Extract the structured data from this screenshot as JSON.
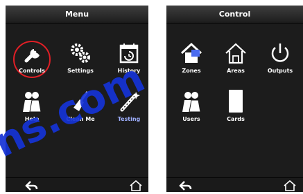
{
  "menu_panel": {
    "title": "Menu",
    "items": [
      {
        "label": "Controls",
        "icon": "wrench-icon"
      },
      {
        "label": "Settings",
        "icon": "gears-icon"
      },
      {
        "label": "History",
        "icon": "calendar-history-icon"
      },
      {
        "label": "Help",
        "icon": "people-icon"
      },
      {
        "label": "Clean Me",
        "icon": "brush-icon"
      },
      {
        "label": "Testing",
        "icon": "wand-icon"
      }
    ]
  },
  "control_panel": {
    "title": "Control",
    "items": [
      {
        "label": "Zones",
        "icon": "house-zone-icon"
      },
      {
        "label": "Areas",
        "icon": "house-outline-icon"
      },
      {
        "label": "Outputs",
        "icon": "power-icon"
      },
      {
        "label": "Users",
        "icon": "people-icon"
      },
      {
        "label": "Cards",
        "icon": "card-icon"
      }
    ]
  },
  "colors": {
    "highlight": "#e01f26",
    "panel_bg": "#1c1c1c",
    "watermark": "#1533d6"
  },
  "watermark_text": "ns.com"
}
